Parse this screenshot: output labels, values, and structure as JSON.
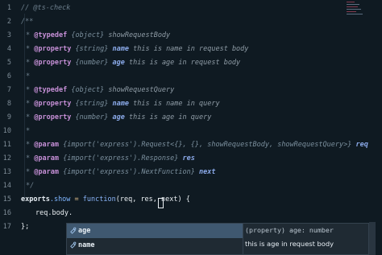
{
  "gutter": [
    "1",
    "2",
    "3",
    "4",
    "5",
    "6",
    "7",
    "8",
    "9",
    "10",
    "11",
    "12",
    "13",
    "14",
    "15",
    "16",
    "17"
  ],
  "lines": {
    "l1": "// @ts-check",
    "l3": "/**",
    "l4": {
      "tag": "@typedef",
      "type": "{object}",
      "name": "showRequestBody"
    },
    "l5": {
      "tag": "@property",
      "type": "{string}",
      "name": "name",
      "desc": "this is name in request body"
    },
    "l6": {
      "tag": "@property",
      "type": "{number}",
      "name": "age",
      "desc": "this is age in request body"
    },
    "l7": "*",
    "l8": {
      "tag": "@typedef",
      "type": "{object}",
      "name": "showRequestQuery"
    },
    "l9": {
      "tag": "@property",
      "type": "{string}",
      "name": "name",
      "desc": "this is name in query"
    },
    "l10": {
      "tag": "@property",
      "type": "{number}",
      "name": "age",
      "desc": "this is age in query"
    },
    "l11": "*",
    "l12": {
      "tag": "@param",
      "type": "{import('express').Request<{}, {}, showRequestBody, showRequestQuery>}",
      "name": "req"
    },
    "l13": {
      "tag": "@param",
      "type": "{import('express').Response}",
      "name": "res"
    },
    "l14": {
      "tag": "@param",
      "type": "{import('express').NextFunction}",
      "name": "next"
    },
    "l15": "*/",
    "l16": {
      "a": "exports",
      "b": ".show",
      "c": " = ",
      "d": "function",
      "e": "(req, res, next) {"
    },
    "l17": "req.body.",
    "l18": "};"
  },
  "suggest": {
    "items": [
      {
        "label": "age",
        "icon": "property-icon",
        "selected": true
      },
      {
        "label": "name",
        "icon": "property-icon",
        "selected": false
      }
    ],
    "detail_signature": "(property) age: number",
    "detail_doc": "this is age in request body"
  },
  "colors": {
    "background": "#0f1a22",
    "selection": "#3f5870",
    "tag": "#c58fd6"
  }
}
